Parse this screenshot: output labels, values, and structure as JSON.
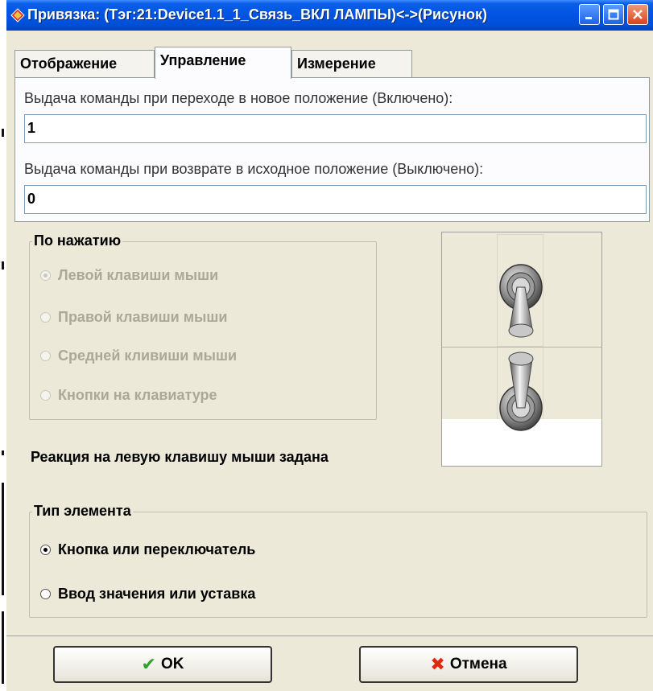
{
  "window": {
    "title": "Привязка: (Тэг:21:Device1.1_1_Связь_ВКЛ ЛАМПЫ)<->(Рисунок)"
  },
  "tabs": [
    {
      "label": "Отображение",
      "active": false
    },
    {
      "label": "Управление",
      "active": true
    },
    {
      "label": "Измерение",
      "active": false
    }
  ],
  "commands": {
    "on_label": "Выдача команды при переходе в новое положение (Включено):",
    "on_value": "1",
    "off_label": "Выдача команды при возврате в исходное положение (Выключено):",
    "off_value": "0"
  },
  "press_group": {
    "title": "По нажатию",
    "options": [
      {
        "label": "Левой клавиши мыши",
        "checked": true
      },
      {
        "label": "Правой клавиши мыши",
        "checked": false
      },
      {
        "label": "Средней кливиши мыши",
        "checked": false
      },
      {
        "label": "Кнопки на клавиатуре",
        "checked": false
      }
    ]
  },
  "status": "Реакция на левую клавишу мыши задана",
  "element_type": {
    "title": "Тип элемента",
    "options": [
      {
        "label": "Кнопка или переключатель",
        "checked": true
      },
      {
        "label": "Ввод значения или уставка",
        "checked": false
      }
    ]
  },
  "buttons": {
    "ok": "OK",
    "cancel": "Отмена"
  },
  "colors": {
    "titlebar": "#0054e3",
    "dialog_bg": "#ece9d8",
    "ok_icon": "#2ea22e",
    "cancel_icon": "#e0280f"
  },
  "icons": {
    "ok": "check-icon",
    "cancel": "x-icon",
    "preview_on": "toggle-switch-down-icon",
    "preview_off": "toggle-switch-up-icon"
  }
}
